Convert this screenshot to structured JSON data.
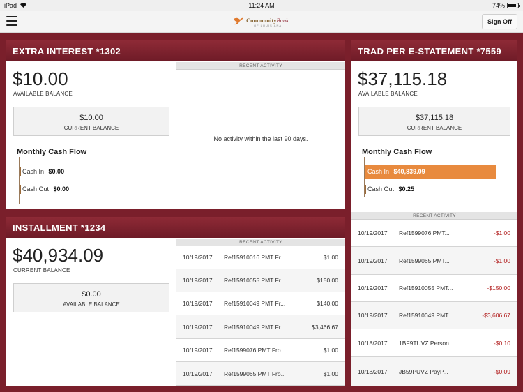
{
  "status_bar": {
    "carrier": "iPad",
    "time": "11:24 AM",
    "battery": "74%",
    "battery_level": 0.74
  },
  "header": {
    "brand": "Community",
    "brand_italic": "Bank",
    "brand_sub": "OF LOUISIANA",
    "sign_off": "Sign Off"
  },
  "accounts": [
    {
      "title": "EXTRA INTEREST *1302",
      "main_amount": "$10.00",
      "main_label": "AVAILABLE BALANCE",
      "sub_amount": "$10.00",
      "sub_label": "CURRENT BALANCE",
      "flow_title": "Monthly Cash Flow",
      "cash_in_label": "Cash In",
      "cash_in": "$0.00",
      "cash_out_label": "Cash Out",
      "cash_out": "$0.00",
      "activity_header": "RECENT ACTIVITY",
      "empty_message": "No activity within the last 90 days."
    },
    {
      "title": "INSTALLMENT *1234",
      "main_amount": "$40,934.09",
      "main_label": "CURRENT BALANCE",
      "sub_amount": "$0.00",
      "sub_label": "AVAILABLE BALANCE",
      "activity_header": "RECENT ACTIVITY",
      "transactions": [
        {
          "date": "10/19/2017",
          "desc": "Ref15910016 PMT Fr...",
          "amount": "$1.00"
        },
        {
          "date": "10/19/2017",
          "desc": "Ref15910055 PMT Fr...",
          "amount": "$150.00"
        },
        {
          "date": "10/19/2017",
          "desc": "Ref15910049 PMT Fr...",
          "amount": "$140.00"
        },
        {
          "date": "10/19/2017",
          "desc": "Ref15910049 PMT Fr...",
          "amount": "$3,466.67"
        },
        {
          "date": "10/19/2017",
          "desc": "Ref1599076 PMT Fro...",
          "amount": "$1.00"
        },
        {
          "date": "10/19/2017",
          "desc": "Ref1599065 PMT Fro...",
          "amount": "$1.00"
        }
      ]
    },
    {
      "title": "TRAD PER E-STATEMENT *7559",
      "main_amount": "$37,115.18",
      "main_label": "AVAILABLE BALANCE",
      "sub_amount": "$37,115.18",
      "sub_label": "CURRENT BALANCE",
      "flow_title": "Monthly Cash Flow",
      "cash_in_label": "Cash In",
      "cash_in": "$40,839.09",
      "cash_out_label": "Cash Out",
      "cash_out": "$0.25",
      "activity_header": "RECENT ACTIVITY",
      "transactions": [
        {
          "date": "10/19/2017",
          "desc": "Ref1599076 PMT...",
          "amount": "-$1.00"
        },
        {
          "date": "10/19/2017",
          "desc": "Ref1599065 PMT...",
          "amount": "-$1.00"
        },
        {
          "date": "10/19/2017",
          "desc": "Ref15910055 PMT...",
          "amount": "-$150.00"
        },
        {
          "date": "10/19/2017",
          "desc": "Ref15910049 PMT...",
          "amount": "-$3,606.67"
        },
        {
          "date": "10/18/2017",
          "desc": "1BF9TUVZ Person...",
          "amount": "-$0.10"
        },
        {
          "date": "10/18/2017",
          "desc": "JB59PUVZ PayP...",
          "amount": "-$0.09"
        }
      ]
    }
  ],
  "colors": {
    "header_bg": "#7a1f2b",
    "cash_in_bar": "#e88a3e",
    "negative": "#b01818"
  }
}
